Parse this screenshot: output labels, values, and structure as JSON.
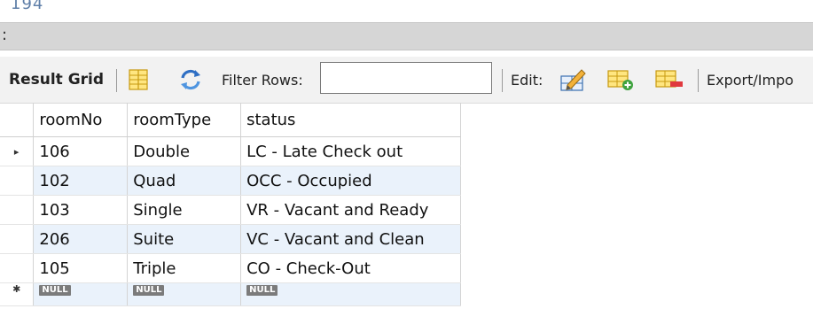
{
  "top_fragment": "194",
  "gray_bar_mark": ":",
  "toolbar": {
    "result_grid_label": "Result Grid",
    "filter_rows_label": "Filter Rows:",
    "filter_rows_value": "",
    "edit_label": "Edit:",
    "export_label": "Export/Impo"
  },
  "grid": {
    "columns": [
      "roomNo",
      "roomType",
      "status"
    ],
    "rows": [
      {
        "marker": "▸",
        "cells": [
          "106",
          "Double",
          "LC - Late Check out"
        ]
      },
      {
        "marker": "",
        "cells": [
          "102",
          "Quad",
          "OCC - Occupied"
        ]
      },
      {
        "marker": "",
        "cells": [
          "103",
          "Single",
          "VR - Vacant and Ready"
        ]
      },
      {
        "marker": "",
        "cells": [
          "206",
          "Suite",
          "VC - Vacant and Clean"
        ]
      },
      {
        "marker": "",
        "cells": [
          "105",
          "Triple",
          "CO - Check-Out"
        ]
      }
    ],
    "null_row": {
      "marker": "✱",
      "cells": [
        "NULL",
        "NULL",
        "NULL"
      ]
    }
  },
  "icons": {
    "form-editor": "form-editor-icon",
    "refresh": "refresh-icon",
    "edit-cell": "edit-cell-icon",
    "add-row": "add-row-icon",
    "delete-row": "delete-row-icon"
  },
  "colors": {
    "alt_row": "#eaf2fb",
    "toolbar_bg": "#f2f2f2",
    "null_badge": "#7b7b7b"
  }
}
